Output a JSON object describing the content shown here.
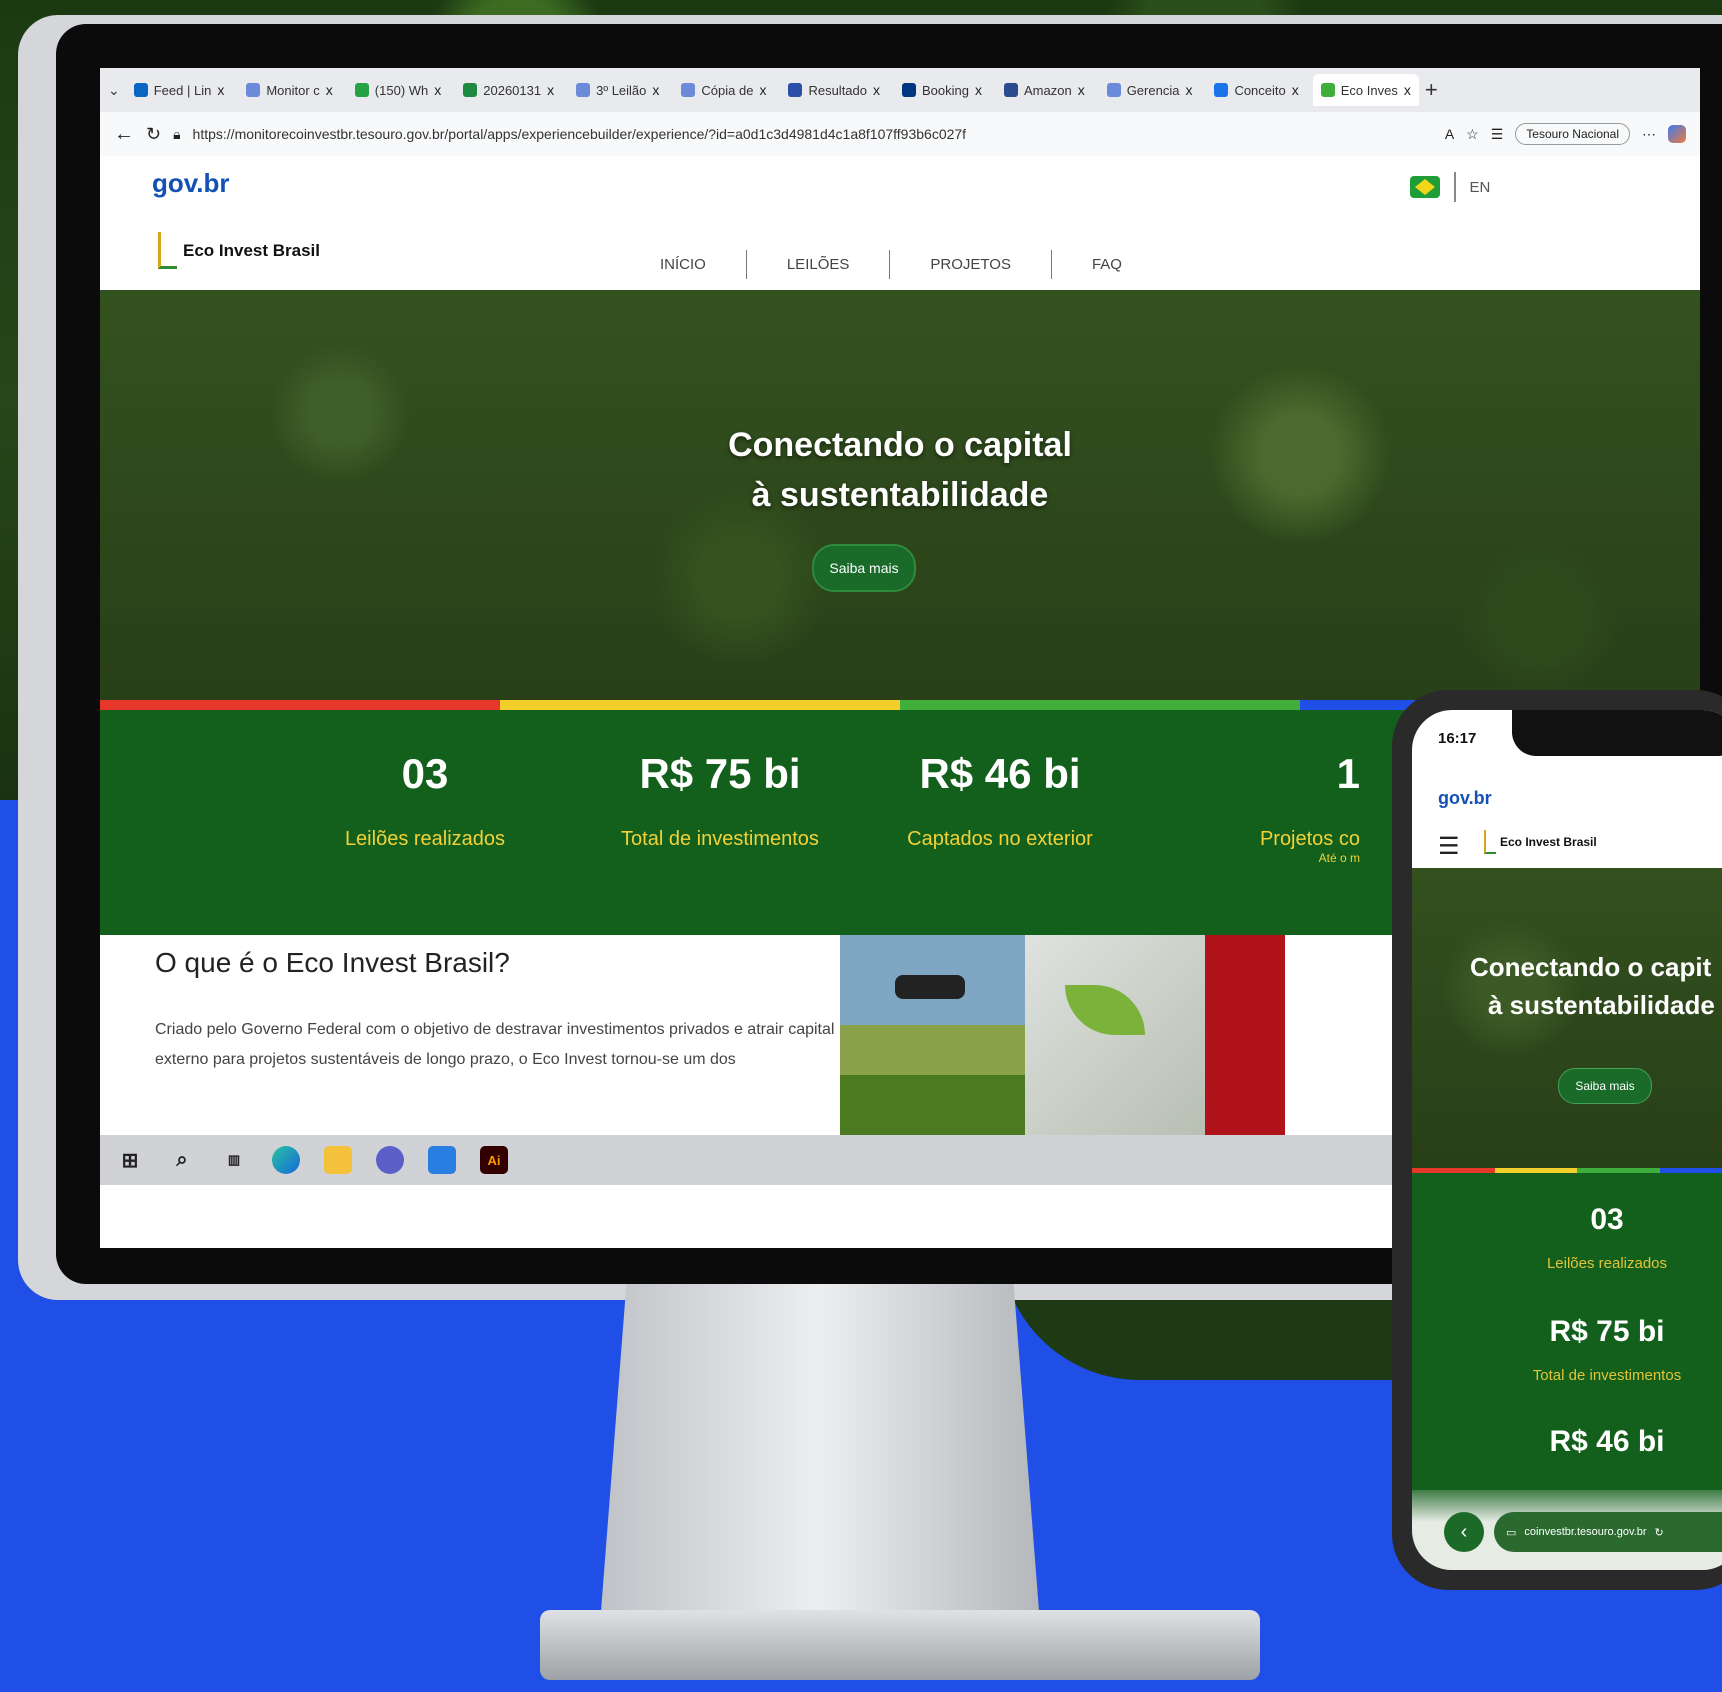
{
  "browser": {
    "tabs": [
      "Feed | Lin",
      "Monitor c",
      "(150) Wh",
      "20260131",
      "3º Leilão",
      "Cópia de",
      "Resultado",
      "Booking",
      "Amazon",
      "Gerencia",
      "Conceito",
      "Eco Inves"
    ],
    "close_glyph": "x",
    "new_tab": "+",
    "url": "https://monitorecoinvestbr.tesouro.gov.br/portal/apps/experiencebuilder/experience/?id=a0d1c3d4981d4c1a8f107ff93b6c027f",
    "profile": "Tesouro Nacional"
  },
  "site": {
    "gov_logo": "gov.br",
    "brand": "Eco Invest Brasil",
    "nav": [
      "INÍCIO",
      "LEILÕES",
      "PROJETOS",
      "FAQ"
    ],
    "lang": "EN",
    "hero": {
      "line1": "Conectando o capital",
      "line2": "à sustentabilidade",
      "button": "Saiba mais"
    },
    "stripe_colors": [
      "#e5382a",
      "#f2cf2a",
      "#3fae3a",
      "#1f4fe6"
    ],
    "stats": [
      {
        "value": "03",
        "label": "Leilões realizados"
      },
      {
        "value": "R$ 75 bi",
        "label": "Total de investimentos"
      },
      {
        "value": "R$ 46 bi",
        "label": "Captados no exterior"
      },
      {
        "value": "1",
        "label": "Projetos co",
        "sub": "Até o m"
      }
    ],
    "about": {
      "title": "O que é o Eco Invest Brasil?",
      "text": "Criado pelo Governo Federal com o objetivo de destravar investimentos privados e atrair capital externo para projetos sustentáveis de longo prazo, o Eco Invest tornou-se um dos"
    }
  },
  "taskbar": {
    "adobe": "Ai"
  },
  "phone": {
    "time": "16:17",
    "gov_logo": "gov.br",
    "brand": "Eco Invest Brasil",
    "hero": {
      "line1": "Conectando o capit",
      "line2": "à sustentabilidade",
      "button": "Saiba mais"
    },
    "stats": [
      {
        "value": "03",
        "label": "Leilões realizados"
      },
      {
        "value": "R$ 75 bi",
        "label": "Total de investimentos"
      },
      {
        "value": "R$ 46 bi"
      }
    ],
    "url": "coinvestbr.tesouro.gov.br"
  }
}
